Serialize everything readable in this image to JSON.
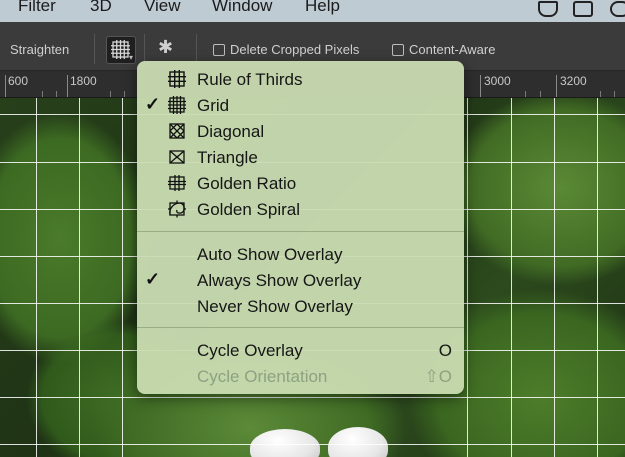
{
  "menubar": {
    "items": [
      "Filter",
      "3D",
      "View",
      "Window",
      "Help"
    ]
  },
  "options_bar": {
    "straighten_label": "Straighten",
    "delete_cropped_label": "Delete Cropped Pixels",
    "content_aware_label": "Content-Aware"
  },
  "ruler": {
    "ticks": [
      "600",
      "1800",
      "3000",
      "3200"
    ]
  },
  "overlay_menu": {
    "overlay_items": [
      {
        "label": "Rule of Thirds",
        "icon": "rule-of-thirds-icon",
        "checked": false
      },
      {
        "label": "Grid",
        "icon": "grid-icon",
        "checked": true
      },
      {
        "label": "Diagonal",
        "icon": "diagonal-icon",
        "checked": false
      },
      {
        "label": "Triangle",
        "icon": "triangle-icon",
        "checked": false
      },
      {
        "label": "Golden Ratio",
        "icon": "golden-ratio-icon",
        "checked": false
      },
      {
        "label": "Golden Spiral",
        "icon": "golden-spiral-icon",
        "checked": false
      }
    ],
    "show_items": [
      {
        "label": "Auto Show Overlay",
        "checked": false
      },
      {
        "label": "Always Show Overlay",
        "checked": true
      },
      {
        "label": "Never Show Overlay",
        "checked": false
      }
    ],
    "cycle_overlay": {
      "label": "Cycle Overlay",
      "shortcut": "O"
    },
    "cycle_orientation": {
      "label": "Cycle Orientation",
      "shortcut": "⇧O",
      "disabled": true
    }
  }
}
